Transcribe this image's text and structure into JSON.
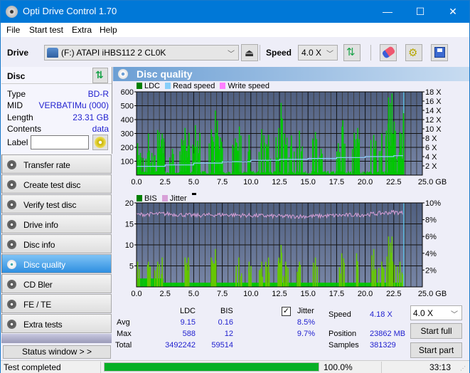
{
  "window": {
    "title": "Opti Drive Control 1.70",
    "controls": {
      "minimize": "—",
      "maximize": "☐",
      "close": "✕"
    }
  },
  "menu": [
    "File",
    "Start test",
    "Extra",
    "Help"
  ],
  "toolbar": {
    "drive_label": "Drive",
    "drive_value": "(F:)  ATAPI iHBS112  2 CL0K",
    "speed_label": "Speed",
    "speed_value": "4.0 X",
    "icons": [
      "drive-icon",
      "eject-icon",
      "refresh-icon",
      "erase-icon",
      "settings-icon",
      "save-icon"
    ]
  },
  "disc": {
    "header": "Disc",
    "rows": [
      {
        "key": "Type",
        "value": "BD-R"
      },
      {
        "key": "MID",
        "value": "VERBATIMu (000)"
      },
      {
        "key": "Length",
        "value": "23.31 GB"
      },
      {
        "key": "Contents",
        "value": "data"
      }
    ],
    "label_key": "Label",
    "label_value": ""
  },
  "nav": [
    {
      "label": "Transfer rate",
      "active": false
    },
    {
      "label": "Create test disc",
      "active": false
    },
    {
      "label": "Verify test disc",
      "active": false
    },
    {
      "label": "Drive info",
      "active": false
    },
    {
      "label": "Disc info",
      "active": false
    },
    {
      "label": "Disc quality",
      "active": true
    },
    {
      "label": "CD Bler",
      "active": false
    },
    {
      "label": "FE / TE",
      "active": false
    },
    {
      "label": "Extra tests",
      "active": false
    }
  ],
  "status_window_button": "Status window > >",
  "panel_title": "Disc quality",
  "chart_data": [
    {
      "type": "bar",
      "title": "LDC / Read speed",
      "legend": [
        {
          "name": "LDC",
          "color": "#008000"
        },
        {
          "name": "Read speed",
          "color": "#87cefa"
        },
        {
          "name": "Write speed",
          "color": "#ff80ff"
        }
      ],
      "xlabel": "GB",
      "xlim": [
        0,
        25
      ],
      "x_ticks": [
        "0.0",
        "2.5",
        "5.0",
        "7.5",
        "10.0",
        "12.5",
        "15.0",
        "17.5",
        "20.0",
        "22.5",
        "25.0 GB"
      ],
      "ylim_left": [
        0,
        600
      ],
      "y_ticks_left": [
        "100",
        "200",
        "300",
        "400",
        "500",
        "600"
      ],
      "ylim_right": [
        0,
        18
      ],
      "y_ticks_right": [
        "2 X",
        "4 X",
        "6 X",
        "8 X",
        "10 X",
        "12 X",
        "14 X",
        "16 X",
        "18 X"
      ],
      "ldc_peaks": [
        {
          "x": 0.05,
          "y": 230
        },
        {
          "x": 0.3,
          "y": 160
        },
        {
          "x": 1.0,
          "y": 300
        },
        {
          "x": 1.3,
          "y": 160
        },
        {
          "x": 1.8,
          "y": 325
        },
        {
          "x": 1.95,
          "y": 310
        },
        {
          "x": 2.2,
          "y": 300
        },
        {
          "x": 3.1,
          "y": 190
        },
        {
          "x": 3.9,
          "y": 260
        },
        {
          "x": 4.2,
          "y": 340
        },
        {
          "x": 4.55,
          "y": 305
        },
        {
          "x": 5.1,
          "y": 360
        },
        {
          "x": 5.5,
          "y": 305
        },
        {
          "x": 6.5,
          "y": 330
        },
        {
          "x": 6.85,
          "y": 465
        },
        {
          "x": 7.1,
          "y": 280
        },
        {
          "x": 7.3,
          "y": 270
        },
        {
          "x": 8.6,
          "y": 265
        },
        {
          "x": 8.95,
          "y": 350
        },
        {
          "x": 9.8,
          "y": 290
        },
        {
          "x": 10.9,
          "y": 330
        },
        {
          "x": 11.5,
          "y": 290
        },
        {
          "x": 12.4,
          "y": 340
        },
        {
          "x": 12.6,
          "y": 520
        },
        {
          "x": 12.9,
          "y": 300
        },
        {
          "x": 13.5,
          "y": 285
        },
        {
          "x": 14.2,
          "y": 320
        },
        {
          "x": 15.6,
          "y": 310
        },
        {
          "x": 16.1,
          "y": 190
        },
        {
          "x": 17.6,
          "y": 230
        },
        {
          "x": 18.0,
          "y": 395
        },
        {
          "x": 19.0,
          "y": 305
        },
        {
          "x": 19.3,
          "y": 340
        },
        {
          "x": 20.7,
          "y": 290
        },
        {
          "x": 21.4,
          "y": 300
        },
        {
          "x": 22.0,
          "y": 560
        },
        {
          "x": 22.3,
          "y": 588
        },
        {
          "x": 22.6,
          "y": 320
        },
        {
          "x": 23.0,
          "y": 310
        },
        {
          "x": 23.3,
          "y": 470
        }
      ],
      "read_speed": [
        {
          "x": 0.0,
          "y": 1.9
        },
        {
          "x": 2.5,
          "y": 2.2
        },
        {
          "x": 5.0,
          "y": 2.6
        },
        {
          "x": 7.5,
          "y": 2.9
        },
        {
          "x": 10.0,
          "y": 3.2
        },
        {
          "x": 12.5,
          "y": 3.4
        },
        {
          "x": 15.0,
          "y": 3.6
        },
        {
          "x": 17.5,
          "y": 3.8
        },
        {
          "x": 20.0,
          "y": 4.0
        },
        {
          "x": 22.5,
          "y": 4.2
        },
        {
          "x": 23.31,
          "y": 4.2
        }
      ]
    },
    {
      "type": "bar",
      "title": "BIS / Jitter",
      "legend": [
        {
          "name": "BIS",
          "color": "#008000"
        },
        {
          "name": "Jitter",
          "color": "#d8a0d8"
        }
      ],
      "xlabel": "GB",
      "xlim": [
        0,
        25
      ],
      "x_ticks": [
        "0.0",
        "2.5",
        "5.0",
        "7.5",
        "10.0",
        "12.5",
        "15.0",
        "17.5",
        "20.0",
        "22.5",
        "25.0 GB"
      ],
      "ylim_left": [
        0,
        20
      ],
      "y_ticks_left": [
        "5",
        "10",
        "15",
        "20"
      ],
      "ylim_right": [
        0,
        10
      ],
      "y_ticks_right": [
        "2%",
        "4%",
        "6%",
        "8%",
        "10%"
      ],
      "bis_peaks": [
        {
          "x": 0.05,
          "y": 6
        },
        {
          "x": 1.0,
          "y": 6
        },
        {
          "x": 1.8,
          "y": 6
        },
        {
          "x": 2.2,
          "y": 7
        },
        {
          "x": 4.2,
          "y": 7
        },
        {
          "x": 4.5,
          "y": 7
        },
        {
          "x": 6.5,
          "y": 7
        },
        {
          "x": 6.85,
          "y": 9
        },
        {
          "x": 8.9,
          "y": 7
        },
        {
          "x": 9.8,
          "y": 6
        },
        {
          "x": 10.9,
          "y": 6
        },
        {
          "x": 11.5,
          "y": 7
        },
        {
          "x": 12.4,
          "y": 7
        },
        {
          "x": 12.6,
          "y": 10
        },
        {
          "x": 13.0,
          "y": 6
        },
        {
          "x": 14.2,
          "y": 6
        },
        {
          "x": 15.6,
          "y": 7
        },
        {
          "x": 17.9,
          "y": 8
        },
        {
          "x": 19.2,
          "y": 8
        },
        {
          "x": 20.7,
          "y": 9
        },
        {
          "x": 21.4,
          "y": 6
        },
        {
          "x": 22.0,
          "y": 12
        },
        {
          "x": 22.3,
          "y": 12
        },
        {
          "x": 23.0,
          "y": 6
        }
      ],
      "jitter_pct": [
        {
          "x": 0.0,
          "y": 8.6
        },
        {
          "x": 2.5,
          "y": 8.7
        },
        {
          "x": 5.0,
          "y": 8.5
        },
        {
          "x": 7.5,
          "y": 8.6
        },
        {
          "x": 10.0,
          "y": 8.5
        },
        {
          "x": 12.5,
          "y": 8.4
        },
        {
          "x": 15.0,
          "y": 8.4
        },
        {
          "x": 17.5,
          "y": 8.5
        },
        {
          "x": 20.0,
          "y": 8.6
        },
        {
          "x": 22.5,
          "y": 8.9
        },
        {
          "x": 23.31,
          "y": 8.8
        }
      ]
    }
  ],
  "results": {
    "col_ldc": "LDC",
    "col_bis": "BIS",
    "jitter_label": "Jitter",
    "jitter_checked": true,
    "rows": [
      {
        "label": "Avg",
        "ldc": "9.15",
        "bis": "0.16",
        "jitter": "8.5%"
      },
      {
        "label": "Max",
        "ldc": "588",
        "bis": "12",
        "jitter": "9.7%"
      },
      {
        "label": "Total",
        "ldc": "3492242",
        "bis": "59514",
        "jitter": ""
      }
    ],
    "speed_label": "Speed",
    "speed_value": "4.18 X",
    "position_label": "Position",
    "position_value": "23862 MB",
    "samples_label": "Samples",
    "samples_value": "381329",
    "speed_select": "4.0 X",
    "start_full": "Start full",
    "start_part": "Start part"
  },
  "statusbar": {
    "text": "Test completed",
    "progress": 100.0,
    "progress_text": "100.0%",
    "time": "33:13"
  }
}
